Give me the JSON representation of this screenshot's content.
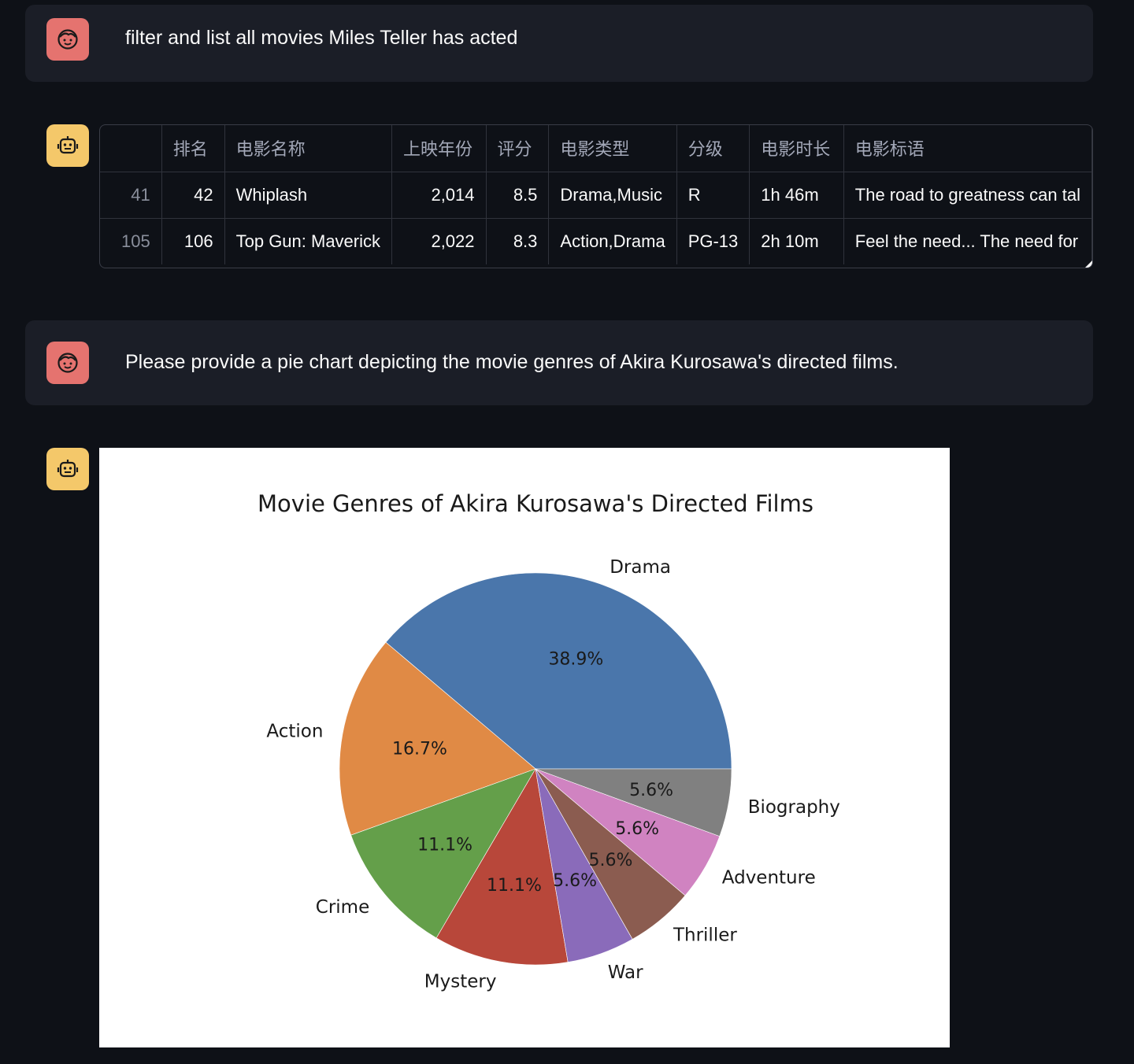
{
  "messages": {
    "user1": {
      "text": "filter and list all movies Miles Teller has acted"
    },
    "user2": {
      "text": "Please provide a pie chart depicting the movie genres of Akira Kurosawa's directed films."
    }
  },
  "table": {
    "columns": [
      "",
      "排名",
      "电影名称",
      "上映年份",
      "评分",
      "电影类型",
      "分级",
      "电影时长",
      "电影标语"
    ],
    "rows": [
      [
        "41",
        "42",
        "Whiplash",
        "2,014",
        "8.5",
        "Drama,Music",
        "R",
        "1h 46m",
        "The road to greatness can tal"
      ],
      [
        "105",
        "106",
        "Top Gun: Maverick",
        "2,022",
        "8.3",
        "Action,Drama",
        "PG-13",
        "2h 10m",
        "Feel the need... The need for"
      ]
    ]
  },
  "icons": {
    "user": "user-face-icon",
    "assistant": "robot-icon"
  },
  "colors": {
    "user_avatar": "#e5736f",
    "bot_avatar": "#f4c86a",
    "background": "#0e1117"
  },
  "chart_data": {
    "type": "pie",
    "title": "Movie Genres of Akira Kurosawa's Directed Films",
    "categories": [
      "Drama",
      "Action",
      "Crime",
      "Mystery",
      "War",
      "Thriller",
      "Adventure",
      "Biography"
    ],
    "values": [
      38.9,
      16.7,
      11.1,
      11.1,
      5.6,
      5.6,
      5.6,
      5.6
    ],
    "labels_pct": [
      "38.9%",
      "16.7%",
      "11.1%",
      "11.1%",
      "5.6%",
      "5.6%",
      "5.6%",
      "5.6%"
    ],
    "colors": [
      "#4a76ab",
      "#e08a45",
      "#649f4a",
      "#b8473a",
      "#8a6bba",
      "#8b5c50",
      "#d083c1",
      "#808080"
    ],
    "start_angle_deg": 0,
    "direction": "counterclockwise"
  }
}
